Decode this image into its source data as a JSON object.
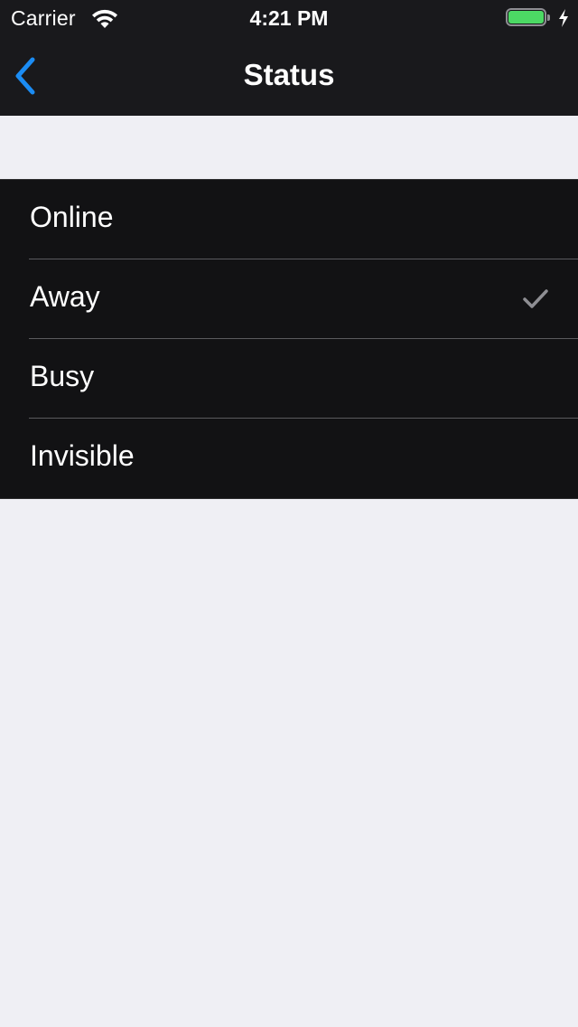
{
  "status_bar": {
    "carrier": "Carrier",
    "time": "4:21 PM",
    "battery_color": "#4cd964",
    "battery_level": 1.0,
    "charging": true
  },
  "nav": {
    "title": "Status",
    "back_icon": "chevron-left-icon",
    "accent_color": "#1b8cf3"
  },
  "status_options": [
    {
      "label": "Online",
      "selected": false
    },
    {
      "label": "Away",
      "selected": true
    },
    {
      "label": "Busy",
      "selected": false
    },
    {
      "label": "Invisible",
      "selected": false
    }
  ],
  "checkmark_color": "#8e8e93"
}
